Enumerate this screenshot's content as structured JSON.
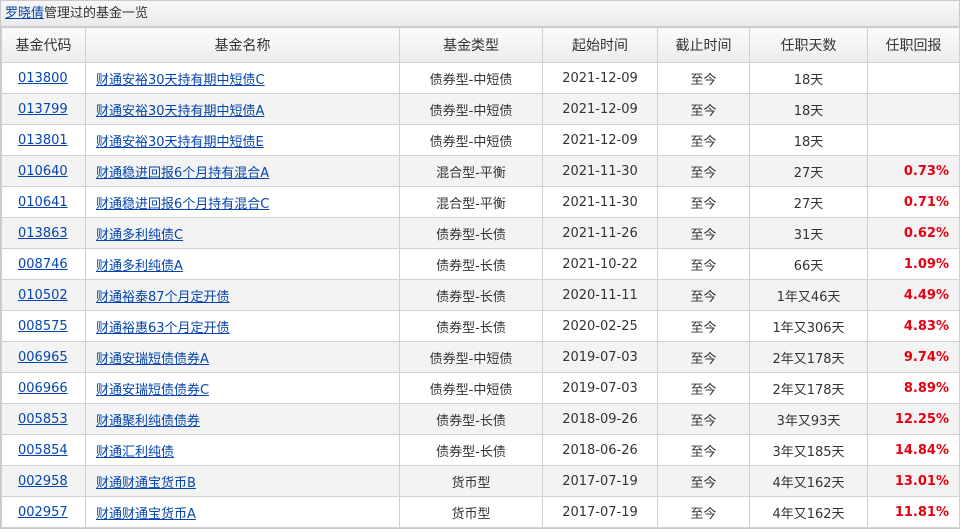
{
  "header": {
    "manager_name": "罗晓倩",
    "title_suffix": "管理过的基金一览"
  },
  "table": {
    "columns": [
      "基金代码",
      "基金名称",
      "基金类型",
      "起始时间",
      "截止时间",
      "任职天数",
      "任职回报"
    ],
    "rows": [
      {
        "code": "013800",
        "name": "财通安裕30天持有期中短债C",
        "type": "债券型-中短债",
        "start": "2021-12-09",
        "end": "至今",
        "days": "18天",
        "return": ""
      },
      {
        "code": "013799",
        "name": "财通安裕30天持有期中短债A",
        "type": "债券型-中短债",
        "start": "2021-12-09",
        "end": "至今",
        "days": "18天",
        "return": ""
      },
      {
        "code": "013801",
        "name": "财通安裕30天持有期中短债E",
        "type": "债券型-中短债",
        "start": "2021-12-09",
        "end": "至今",
        "days": "18天",
        "return": ""
      },
      {
        "code": "010640",
        "name": "财通稳进回报6个月持有混合A",
        "type": "混合型-平衡",
        "start": "2021-11-30",
        "end": "至今",
        "days": "27天",
        "return": "0.73%"
      },
      {
        "code": "010641",
        "name": "财通稳进回报6个月持有混合C",
        "type": "混合型-平衡",
        "start": "2021-11-30",
        "end": "至今",
        "days": "27天",
        "return": "0.71%"
      },
      {
        "code": "013863",
        "name": "财通多利纯债C",
        "type": "债券型-长债",
        "start": "2021-11-26",
        "end": "至今",
        "days": "31天",
        "return": "0.62%"
      },
      {
        "code": "008746",
        "name": "财通多利纯债A",
        "type": "债券型-长债",
        "start": "2021-10-22",
        "end": "至今",
        "days": "66天",
        "return": "1.09%"
      },
      {
        "code": "010502",
        "name": "财通裕泰87个月定开债",
        "type": "债券型-长债",
        "start": "2020-11-11",
        "end": "至今",
        "days": "1年又46天",
        "return": "4.49%"
      },
      {
        "code": "008575",
        "name": "财通裕惠63个月定开债",
        "type": "债券型-长债",
        "start": "2020-02-25",
        "end": "至今",
        "days": "1年又306天",
        "return": "4.83%"
      },
      {
        "code": "006965",
        "name": "财通安瑞短债债券A",
        "type": "债券型-中短债",
        "start": "2019-07-03",
        "end": "至今",
        "days": "2年又178天",
        "return": "9.74%"
      },
      {
        "code": "006966",
        "name": "财通安瑞短债债券C",
        "type": "债券型-中短债",
        "start": "2019-07-03",
        "end": "至今",
        "days": "2年又178天",
        "return": "8.89%"
      },
      {
        "code": "005853",
        "name": "财通聚利纯债债券",
        "type": "债券型-长债",
        "start": "2018-09-26",
        "end": "至今",
        "days": "3年又93天",
        "return": "12.25%"
      },
      {
        "code": "005854",
        "name": "财通汇利纯债",
        "type": "债券型-长债",
        "start": "2018-06-26",
        "end": "至今",
        "days": "3年又185天",
        "return": "14.84%"
      },
      {
        "code": "002958",
        "name": "财通财通宝货币B",
        "type": "货币型",
        "start": "2017-07-19",
        "end": "至今",
        "days": "4年又162天",
        "return": "13.01%"
      },
      {
        "code": "002957",
        "name": "财通财通宝货币A",
        "type": "货币型",
        "start": "2017-07-19",
        "end": "至今",
        "days": "4年又162天",
        "return": "11.81%"
      }
    ]
  },
  "colors": {
    "link": "#0645ad",
    "return_positive": "#e60012"
  }
}
